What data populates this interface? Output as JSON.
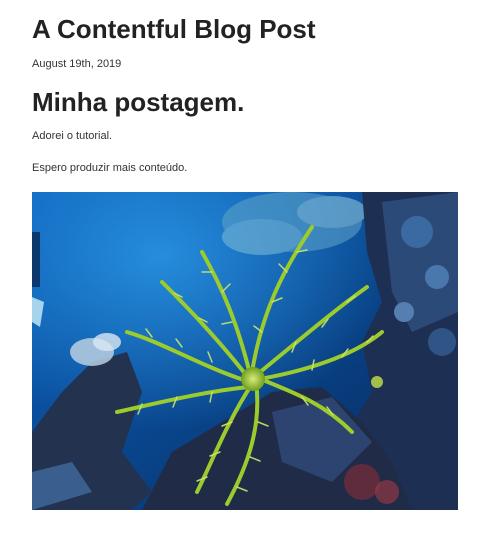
{
  "post": {
    "site_title": "A Contentful Blog Post",
    "date": "August 19th, 2019",
    "heading": "Minha postagem.",
    "paragraphs": [
      "Adorei o tutorial.",
      "Espero produzir mais conteúdo."
    ],
    "image": {
      "subject": "underwater-reef-feather-star"
    }
  },
  "colors": {
    "text": "#222222",
    "muted_text": "#333333",
    "background": "#ffffff",
    "water_deep": "#0a3f86",
    "water_light": "#1a7fd6",
    "feather_star": "#9ccb2d",
    "reef": "#2a3550"
  }
}
